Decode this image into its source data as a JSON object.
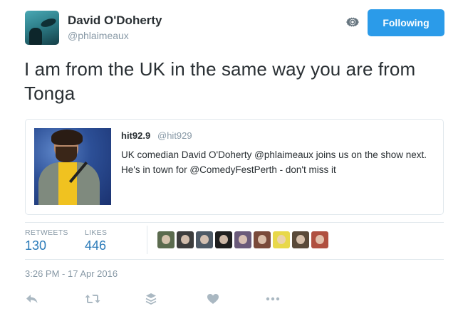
{
  "author": {
    "name": "David O'Doherty",
    "handle": "@phlaimeaux"
  },
  "header": {
    "follow_label": "Following",
    "gear_icon": "gear-icon"
  },
  "tweet": {
    "text": "I am from the UK in the same way you are from Tonga"
  },
  "quoted": {
    "name": "hit92.9",
    "handle": "@hit929",
    "text": "UK comedian David O'Doherty @phlaimeaux joins us on the show next. He's in town for @ComedyFestPerth - don't miss it"
  },
  "stats": {
    "retweets_label": "RETWEETS",
    "retweets_value": "130",
    "likes_label": "LIKES",
    "likes_value": "446"
  },
  "liker_avatars": [
    {
      "color": "#5b6b4e"
    },
    {
      "color": "#3d3d3d"
    },
    {
      "color": "#4e5a66"
    },
    {
      "color": "#1f1f1f"
    },
    {
      "color": "#6a5a7a"
    },
    {
      "color": "#7a4a3a"
    },
    {
      "color": "#e8d84a"
    },
    {
      "color": "#5a4a3a"
    },
    {
      "color": "#b05040"
    }
  ],
  "timestamp": "3:26 PM - 17 Apr 2016",
  "actions": [
    "reply-icon",
    "retweet-icon",
    "buffer-icon",
    "like-icon",
    "more-icon"
  ],
  "colors": {
    "accent": "#2b9be9",
    "stat_value": "#2b7bb9",
    "muted": "#8899a6",
    "text": "#292f33"
  }
}
